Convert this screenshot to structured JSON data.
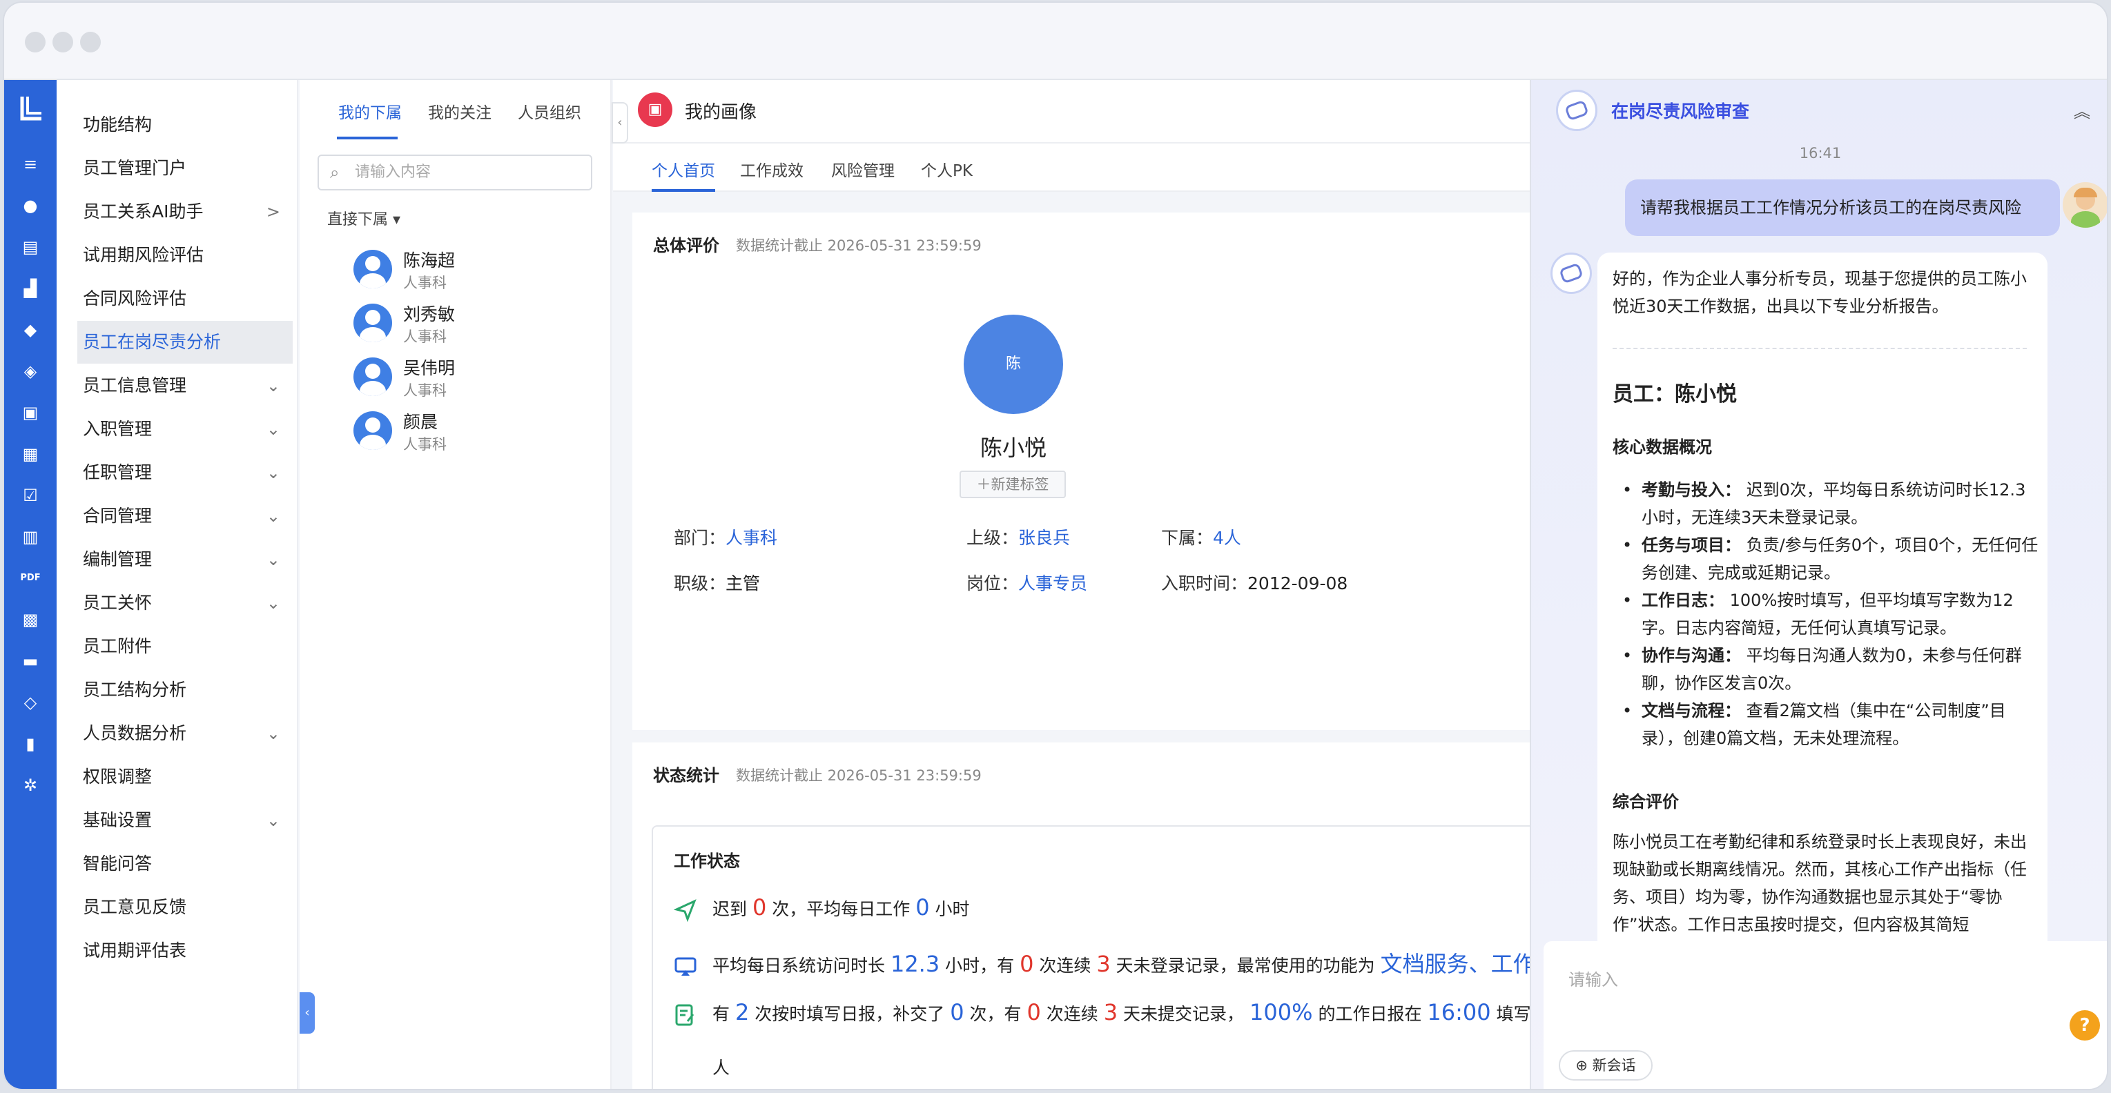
{
  "menu": {
    "items": [
      {
        "label": "功能结构",
        "chev": ""
      },
      {
        "label": "员工管理门户",
        "chev": ""
      },
      {
        "label": "员工关系AI助手",
        "chev": ">"
      },
      {
        "label": "试用期风险评估",
        "chev": ""
      },
      {
        "label": "合同风险评估",
        "chev": ""
      },
      {
        "label": "员工在岗尽责分析",
        "chev": ""
      },
      {
        "label": "员工信息管理",
        "chev": "⌄"
      },
      {
        "label": "入职管理",
        "chev": "⌄"
      },
      {
        "label": "任职管理",
        "chev": "⌄"
      },
      {
        "label": "合同管理",
        "chev": "⌄"
      },
      {
        "label": "编制管理",
        "chev": "⌄"
      },
      {
        "label": "员工关怀",
        "chev": "⌄"
      },
      {
        "label": "员工附件",
        "chev": ""
      },
      {
        "label": "员工结构分析",
        "chev": ""
      },
      {
        "label": "人员数据分析",
        "chev": "⌄"
      },
      {
        "label": "权限调整",
        "chev": ""
      },
      {
        "label": "基础设置",
        "chev": "⌄"
      },
      {
        "label": "智能问答",
        "chev": ""
      },
      {
        "label": "员工意见反馈",
        "chev": ""
      },
      {
        "label": "试用期评估表",
        "chev": ""
      }
    ]
  },
  "org": {
    "tabs": [
      "我的下属",
      "我的关注",
      "人员组织"
    ],
    "search_placeholder": "请输入内容",
    "filter": "直接下属 ▾",
    "people": [
      {
        "name": "陈海超",
        "dept": "人事科"
      },
      {
        "name": "刘秀敏",
        "dept": "人事科"
      },
      {
        "name": "吴伟明",
        "dept": "人事科"
      },
      {
        "name": "颜晨",
        "dept": "人事科"
      }
    ]
  },
  "main": {
    "title": "我的画像",
    "tabs": [
      "个人首页",
      "工作成效",
      "风险管理",
      "个人PK"
    ],
    "overall": {
      "title": "总体评价",
      "stat_note": "数据统计截止 2026-05-31 23:59:59",
      "avatar_char": "陈",
      "name": "陈小悦",
      "tag_button": "＋新建标签",
      "dept_label": "部门：",
      "dept": "人事科",
      "superior_label": "上级：",
      "superior": "张良兵",
      "subordinate_label": "下属：",
      "subordinate": "4人",
      "rank_label": "职级：",
      "rank": "主管",
      "post_label": "岗位：",
      "post": "人事专员",
      "join_label": "入职时间：",
      "join": "2012-09-08"
    },
    "status": {
      "title": "状态统计",
      "stat_note": "数据统计截止 2026-05-31 23:59:59",
      "work_title": "工作状态",
      "row1": {
        "a": "迟到 ",
        "late": "0",
        "b": " 次，平均每日工作 ",
        "hours": "0",
        "c": " 小时"
      },
      "row2": {
        "a": "平均每日系统访问时长 ",
        "visit": "12.3",
        "b": " 小时，有 ",
        "n1": "0",
        "c": " 次连续 ",
        "n2": "3",
        "d": " 天未登录记录，最常使用的功能为 ",
        "func": "文档服务、工作"
      },
      "row3": {
        "a": "有 ",
        "n1": "2",
        "b": " 次按时填写日报，补交了 ",
        "n2": "0",
        "c": " 次，有 ",
        "n3": "0",
        "d": " 次连续 ",
        "n4": "3",
        "e": " 天未提交记录， ",
        "pct": "100%",
        "f": " 的工作日报在 ",
        "time": "16:00",
        "g": " 填写"
      },
      "row4": "人"
    }
  },
  "chat": {
    "title": "在岗尽责风险审查",
    "time": "16:41",
    "user_msg": "请帮我根据员工工作情况分析该员工的在岗尽责风险",
    "reply": {
      "intro": "好的，作为企业人事分析专员，现基于您提供的员工陈小悦近30天工作数据，出具以下专业分析报告。",
      "employee": "员工：陈小悦",
      "core_title": "核心数据概况",
      "items": [
        {
          "k": "考勤与投入：",
          "v": " 迟到0次，平均每日系统访问时长12.3小时，无连续3天未登录记录。"
        },
        {
          "k": "任务与项目：",
          "v": " 负责/参与任务0个，项目0个，无任何任务创建、完成或延期记录。"
        },
        {
          "k": "工作日志：",
          "v": " 100%按时填写，但平均填写字数为12字。日志内容简短，无任何认真填写记录。"
        },
        {
          "k": "协作与沟通：",
          "v": " 平均每日沟通人数为0，未参与任何群聊，协作区发言0次。"
        },
        {
          "k": "文档与流程：",
          "v": " 查看2篇文档（集中在“公司制度”目录），创建0篇文档，无未处理流程。"
        }
      ],
      "summary_title": "综合评价",
      "summary": "陈小悦员工在考勤纪律和系统登录时长上表现良好，未出现缺勤或长期离线情况。然而，其核心工作产出指标（任务、项目）均为零，协作沟通数据也显示其处于“零协作”状态。工作日志虽按时提交，但内容极其简短"
    },
    "input_placeholder": "请输入",
    "new_chat": "新会话",
    "help": "?"
  }
}
